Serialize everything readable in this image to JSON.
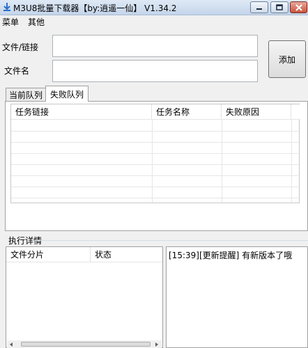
{
  "window": {
    "title": "M3U8批量下载器【by:逍遥一仙】  V1.34.2"
  },
  "menu": {
    "items": [
      "菜单",
      "其他"
    ]
  },
  "form": {
    "file_label": "文件/链接",
    "file_value": "",
    "name_label": "文件名",
    "name_value": "",
    "add_button": "添加"
  },
  "tabs": {
    "current_label": "当前队列",
    "failed_label": "失败队列",
    "active": "失败队列"
  },
  "failed_table": {
    "columns": [
      "任务链接",
      "任务名称",
      "失败原因"
    ],
    "rows": []
  },
  "details": {
    "group_label": "执行详情",
    "segments_columns": [
      "文件分片",
      "状态"
    ],
    "log": [
      "[15:39][更新提醒] 有新版本了哦"
    ]
  },
  "colors": {
    "titlebar": "#c4d5ea",
    "close_button": "#c9533d"
  }
}
